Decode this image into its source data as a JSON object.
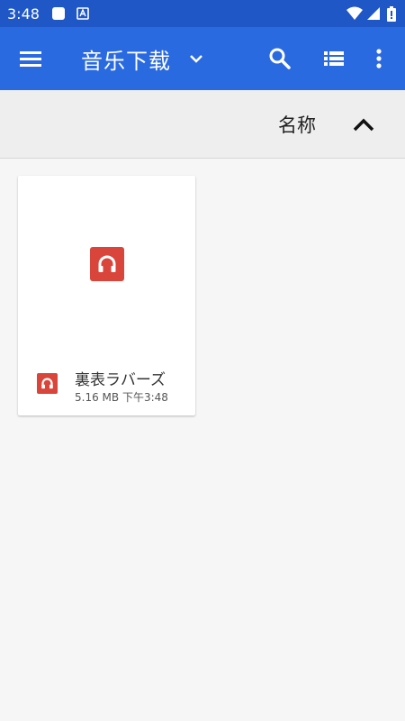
{
  "status_bar": {
    "time": "3:48",
    "icons": [
      "notification-square-icon",
      "app-a-icon",
      "wifi-icon",
      "signal-icon",
      "battery-icon"
    ]
  },
  "app_bar": {
    "title": "音乐下载",
    "icons": [
      "menu-icon",
      "dropdown-chevron-icon",
      "search-icon",
      "list-view-icon",
      "more-options-icon"
    ],
    "color": "#2a6ae0"
  },
  "sort_bar": {
    "label": "名称",
    "direction_icon": "chevron-up-icon"
  },
  "files": [
    {
      "name": "裏表ラバーズ",
      "size": "5.16 MB",
      "time": "下午3:48",
      "icon": "headphones-audio-icon",
      "icon_color": "#d9443b"
    }
  ]
}
